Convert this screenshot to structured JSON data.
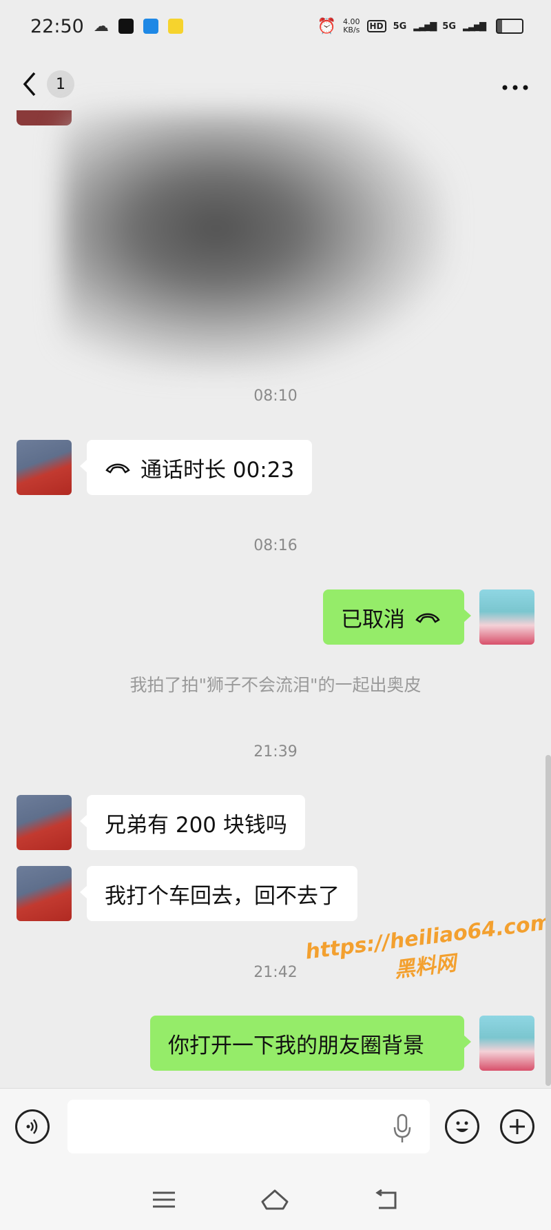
{
  "status_bar": {
    "time": "22:50",
    "net_speed": "4.00",
    "net_unit": "KB/s",
    "hd": "HD",
    "sig1": "5G",
    "sig2": "5G"
  },
  "header": {
    "unread_count": "1",
    "back_icon": "chevron-left-icon",
    "more_icon": "more-dots-icon"
  },
  "messages": {
    "ts1": "08:10",
    "call_text": "通话时长 00:23",
    "ts2": "08:16",
    "cancel_text": "已取消",
    "system_pat": "我拍了拍\"狮子不会流泪\"的一起出奥皮",
    "ts3": "21:39",
    "msg1": "兄弟有 200 块钱吗",
    "msg2": "我打个车回去，回不去了",
    "ts4": "21:42",
    "msg3": "你打开一下我的朋友圈背景"
  },
  "watermark": {
    "line1": "https://heiliao64.com",
    "line2": "黑料网"
  },
  "colors": {
    "background": "#ededed",
    "sent_bubble": "#95ec69",
    "received_bubble": "#ffffff"
  }
}
